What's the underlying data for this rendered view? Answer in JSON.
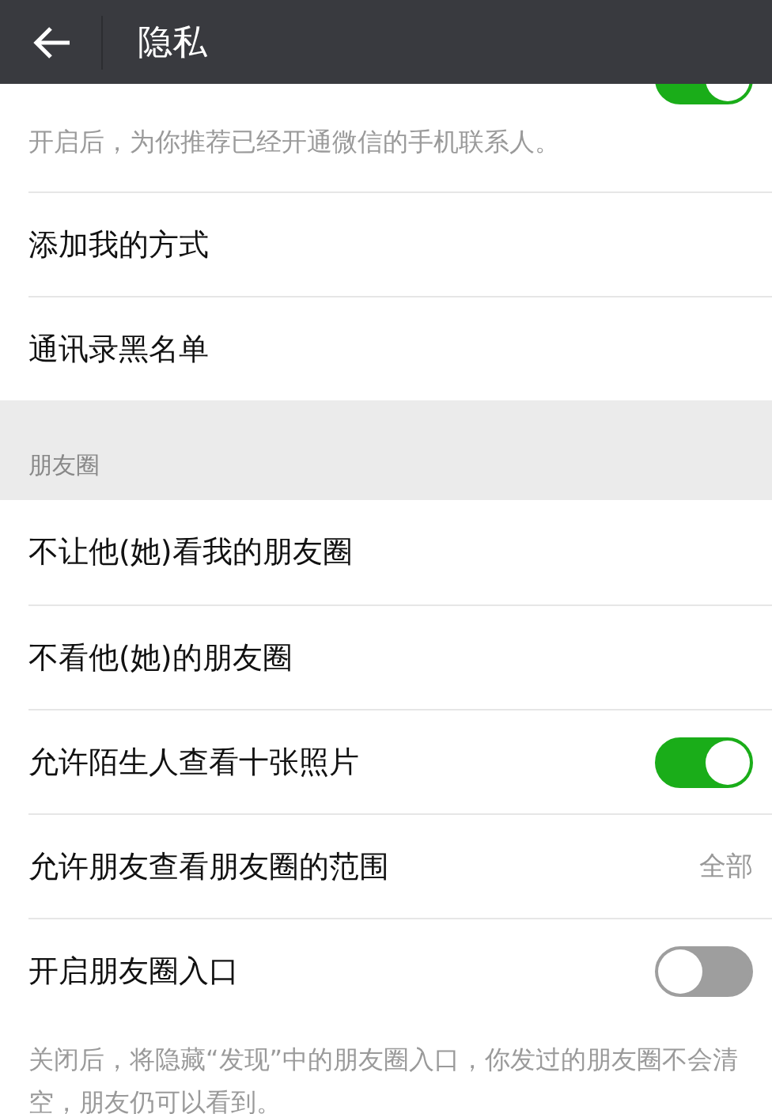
{
  "header": {
    "title": "隐私"
  },
  "items": [
    {
      "kind": "partial_toggle",
      "on": true
    },
    {
      "kind": "hint",
      "text": "开启后，为你推荐已经开通微信的手机联系人。"
    },
    {
      "kind": "link",
      "label": "添加我的方式"
    },
    {
      "kind": "link",
      "label": "通讯录黑名单"
    },
    {
      "kind": "section",
      "label": "朋友圈"
    },
    {
      "kind": "link",
      "label": "不让他(她)看我的朋友圈"
    },
    {
      "kind": "link",
      "label": "不看他(她)的朋友圈"
    },
    {
      "kind": "toggle",
      "label": "允许陌生人查看十张照片",
      "on": true
    },
    {
      "kind": "value",
      "label": "允许朋友查看朋友圈的范围",
      "value": "全部"
    },
    {
      "kind": "toggle",
      "label": "开启朋友圈入口",
      "on": false
    },
    {
      "kind": "hint",
      "text": "关闭后，将隐藏“发现”中的朋友圈入口，你发过的朋友圈不会清空，朋友仍可以看到。"
    }
  ]
}
